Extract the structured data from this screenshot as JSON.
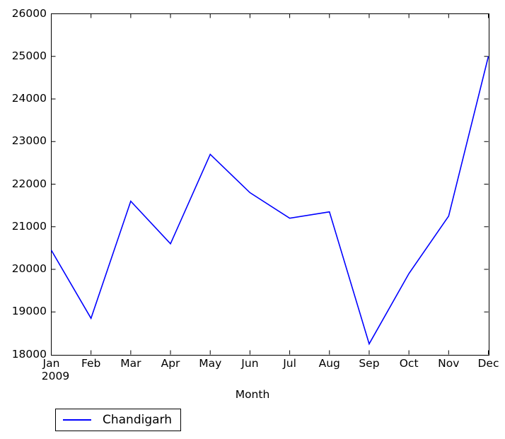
{
  "chart_data": {
    "type": "line",
    "title": "",
    "xlabel": "Month",
    "ylabel": "",
    "categories": [
      "Jan",
      "Feb",
      "Mar",
      "Apr",
      "May",
      "Jun",
      "Jul",
      "Aug",
      "Sep",
      "Oct",
      "Nov",
      "Dec"
    ],
    "x_secondary_label": "2009",
    "ylim": [
      18000,
      26000
    ],
    "yticks": [
      18000,
      19000,
      20000,
      21000,
      22000,
      23000,
      24000,
      25000,
      26000
    ],
    "ytick_labels": [
      "18000",
      "19000",
      "20000",
      "21000",
      "22000",
      "23000",
      "24000",
      "25000",
      "26000"
    ],
    "grid": false,
    "legend_position": "below-left",
    "series": [
      {
        "name": "Chandigarh",
        "color": "#0000ff",
        "values": [
          20450,
          18850,
          21600,
          20600,
          22700,
          21800,
          21200,
          21350,
          18250,
          19900,
          21250,
          25000
        ]
      }
    ]
  },
  "legend": {
    "entries": [
      {
        "label": "Chandigarh",
        "color": "#0000ff"
      }
    ]
  },
  "axis": {
    "x_title": "Month",
    "year_label": "2009"
  },
  "colors": {
    "series_blue": "#0000ff",
    "axis_black": "#000000",
    "background": "#ffffff"
  }
}
